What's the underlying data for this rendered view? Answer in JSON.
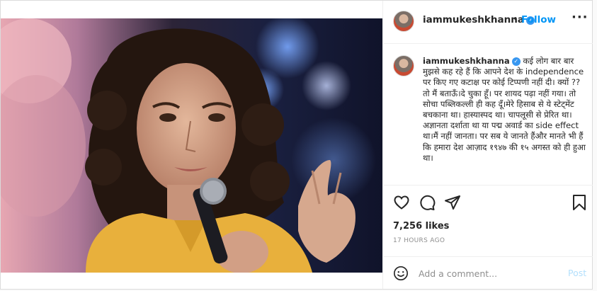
{
  "header": {
    "username": "iammukeshkhanna",
    "dot": "•",
    "follow_label": "Follow",
    "more": "···"
  },
  "caption": {
    "username": "iammukeshkhanna",
    "text": "कई लोग बार बार मुझसे कह रहे हैं कि आपने देश के independence पर किए गए कटाक्ष पर कोई टिप्पणी नहीं दी। क्यों ??\nतो मैं बताऊँ।दे चुका हूँ। पर शायद पढ़ा नहीं गया। तो सोचा पब्लिकल्ली ही कह दूँ।मेरे हिसाब से ये स्टेट्मेंट बचकाना था। हास्यास्पद था। चापलूसी से प्रेरित था।अज्ञानता दर्शाता था या पद्म अवार्ड का side effect था।मैं नहीं जानता। पर सब ये जानते हैंऔर मानते भी हैं कि हमारा देश आज़ाद १९४७ की १५ अगस्त को ही हुआ था।"
  },
  "actions": {
    "like_icon": "heart-icon",
    "comment_icon": "comment-icon",
    "share_icon": "paper-plane-icon",
    "save_icon": "bookmark-icon"
  },
  "likes": "7,256 likes",
  "time": "17 HOURS AGO",
  "comment": {
    "placeholder": "Add a comment...",
    "post_label": "Post",
    "emoji_icon": "smiley-icon"
  },
  "colors": {
    "accent": "#0095f6",
    "verified": "#3897f0",
    "post_disabled": "#b2dffc"
  }
}
